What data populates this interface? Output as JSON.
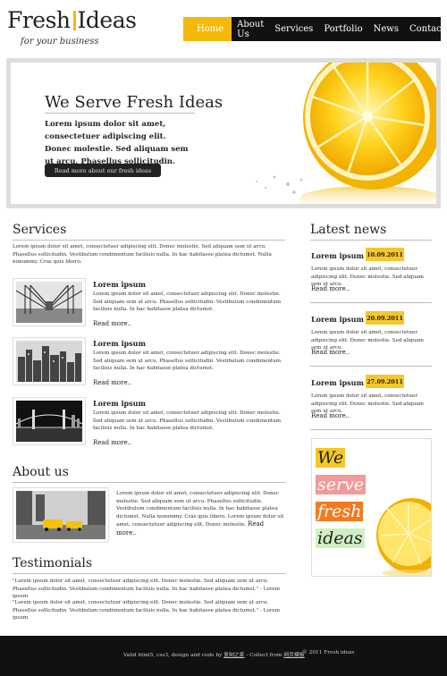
{
  "header": {
    "logo_part1": "Fresh",
    "logo_part2": "Ideas",
    "tagline": "for your business",
    "nav": [
      "Home",
      "About Us",
      "Services",
      "Portfolio",
      "News",
      "Contact"
    ]
  },
  "banner": {
    "title": "We Serve Fresh Ideas",
    "text": "Lorem ipsum dolor sit amet, consectetuer adipiscing elit. Donec molestie. Sed aliquam sem ut arcu. Phasellus sollicitudin.",
    "button": "Read more about our fresh ideas"
  },
  "services": {
    "heading": "Services",
    "intro": "Lorem ipsum dolor sit amet, consectetuer adipiscing elit. Donec molestie. Sed aliquam sem ut arcu. Phasellus sollicitudin. Vestibulum condimentum facilisis nulla. In hac habitasse platea dictumst. Nulla nonummy. Cras quis libero.",
    "items": [
      {
        "title": "Lorem ipsum",
        "text": "Lorem ipsum dolor sit amet, consectetuer adipiscing elit. Donec molestie. Sed aliquam sem ut arcu. Phasellus sollicitudin. Vestibulum condimentum facilisis nulla. In hac habitasse platea dictumst.",
        "more": "Read more.."
      },
      {
        "title": "Lorem ipsum",
        "text": "Lorem ipsum dolor sit amet, consectetuer adipiscing elit. Donec molestie. Sed aliquam sem ut arcu. Phasellus sollicitudin. Vestibulum condimentum facilisis nulla. In hac habitasse platea dictumst.",
        "more": "Read more.."
      },
      {
        "title": "Lorem ipsum",
        "text": "Lorem ipsum dolor sit amet, consectetuer adipiscing elit. Donec molestie. Sed aliquam sem ut arcu. Phasellus sollicitudin. Vestibulum condimentum facilisis nulla. In hac habitasse platea dictumst.",
        "more": "Read more.."
      }
    ]
  },
  "about": {
    "heading": "About us",
    "text": "Lorem ipsum dolor sit amet, consectetuer adipiscing elit. Donec molestie. Sed aliquam sem ut arcu. Phasellus sollicitudin. Vestibulum condimentum facilisis nulla. In hac habitasse platea dictumst. Nulla nonummy. Cras quis libero. Lorem ipsum dolor sit amet, consectetuer adipiscing elit. Donec molestie.",
    "more": "Read more.."
  },
  "testimonials": {
    "heading": "Testimonials",
    "items": [
      "\"Lorem ipsum dolor sit amet, consectetuer adipiscing elit. Donec molestie. Sed aliquam sem ut arcu. Phasellus sollicitudin. Vestibulum condimentum facilisis nulla. In hac habitasse platea dictumst.\" - Lorem ipsum",
      "\"Lorem ipsum dolor sit amet, consectetuer adipiscing elit. Donec molestie. Sed aliquam sem ut arcu. Phasellus sollicitudin. Vestibulum condimentum facilisis nulla. In hac habitasse platea dictumst.\" - Lorem ipsum"
    ]
  },
  "news": {
    "heading": "Latest news",
    "items": [
      {
        "title": "Lorem ipsum",
        "date": "10.09.2011",
        "text": "Lorem ipsum dolor sit amet, consectetuer adipiscing elit. Donec molestie. Sed aliquam sem ut arcu.",
        "more": "Read more.."
      },
      {
        "title": "Lorem ipsum",
        "date": "20.09.2011",
        "text": "Lorem ipsum dolor sit amet, consectetuer adipiscing elit. Donec molestie. Sed aliquam sem ut arcu.",
        "more": "Read more.."
      },
      {
        "title": "Lorem ipsum",
        "date": "27.09.2011",
        "text": "Lorem ipsum dolor sit amet, consectetuer adipiscing elit. Donec molestie. Sed aliquam sem ut arcu.",
        "more": "Read more.."
      }
    ]
  },
  "promo": {
    "words": [
      "We",
      "serve",
      "fresh",
      "ideas"
    ]
  },
  "footer": {
    "credit_prefix": "Valid html5, css3, design and code by",
    "credit_author": "复制之家",
    "credit_mid": "- Collect from",
    "credit_link": "网页模板",
    "copyright": "© 2011 Fresh ideas"
  },
  "colors": {
    "accent": "#f6b90a",
    "dark": "#111111",
    "date_badge": "#f6c72a"
  }
}
